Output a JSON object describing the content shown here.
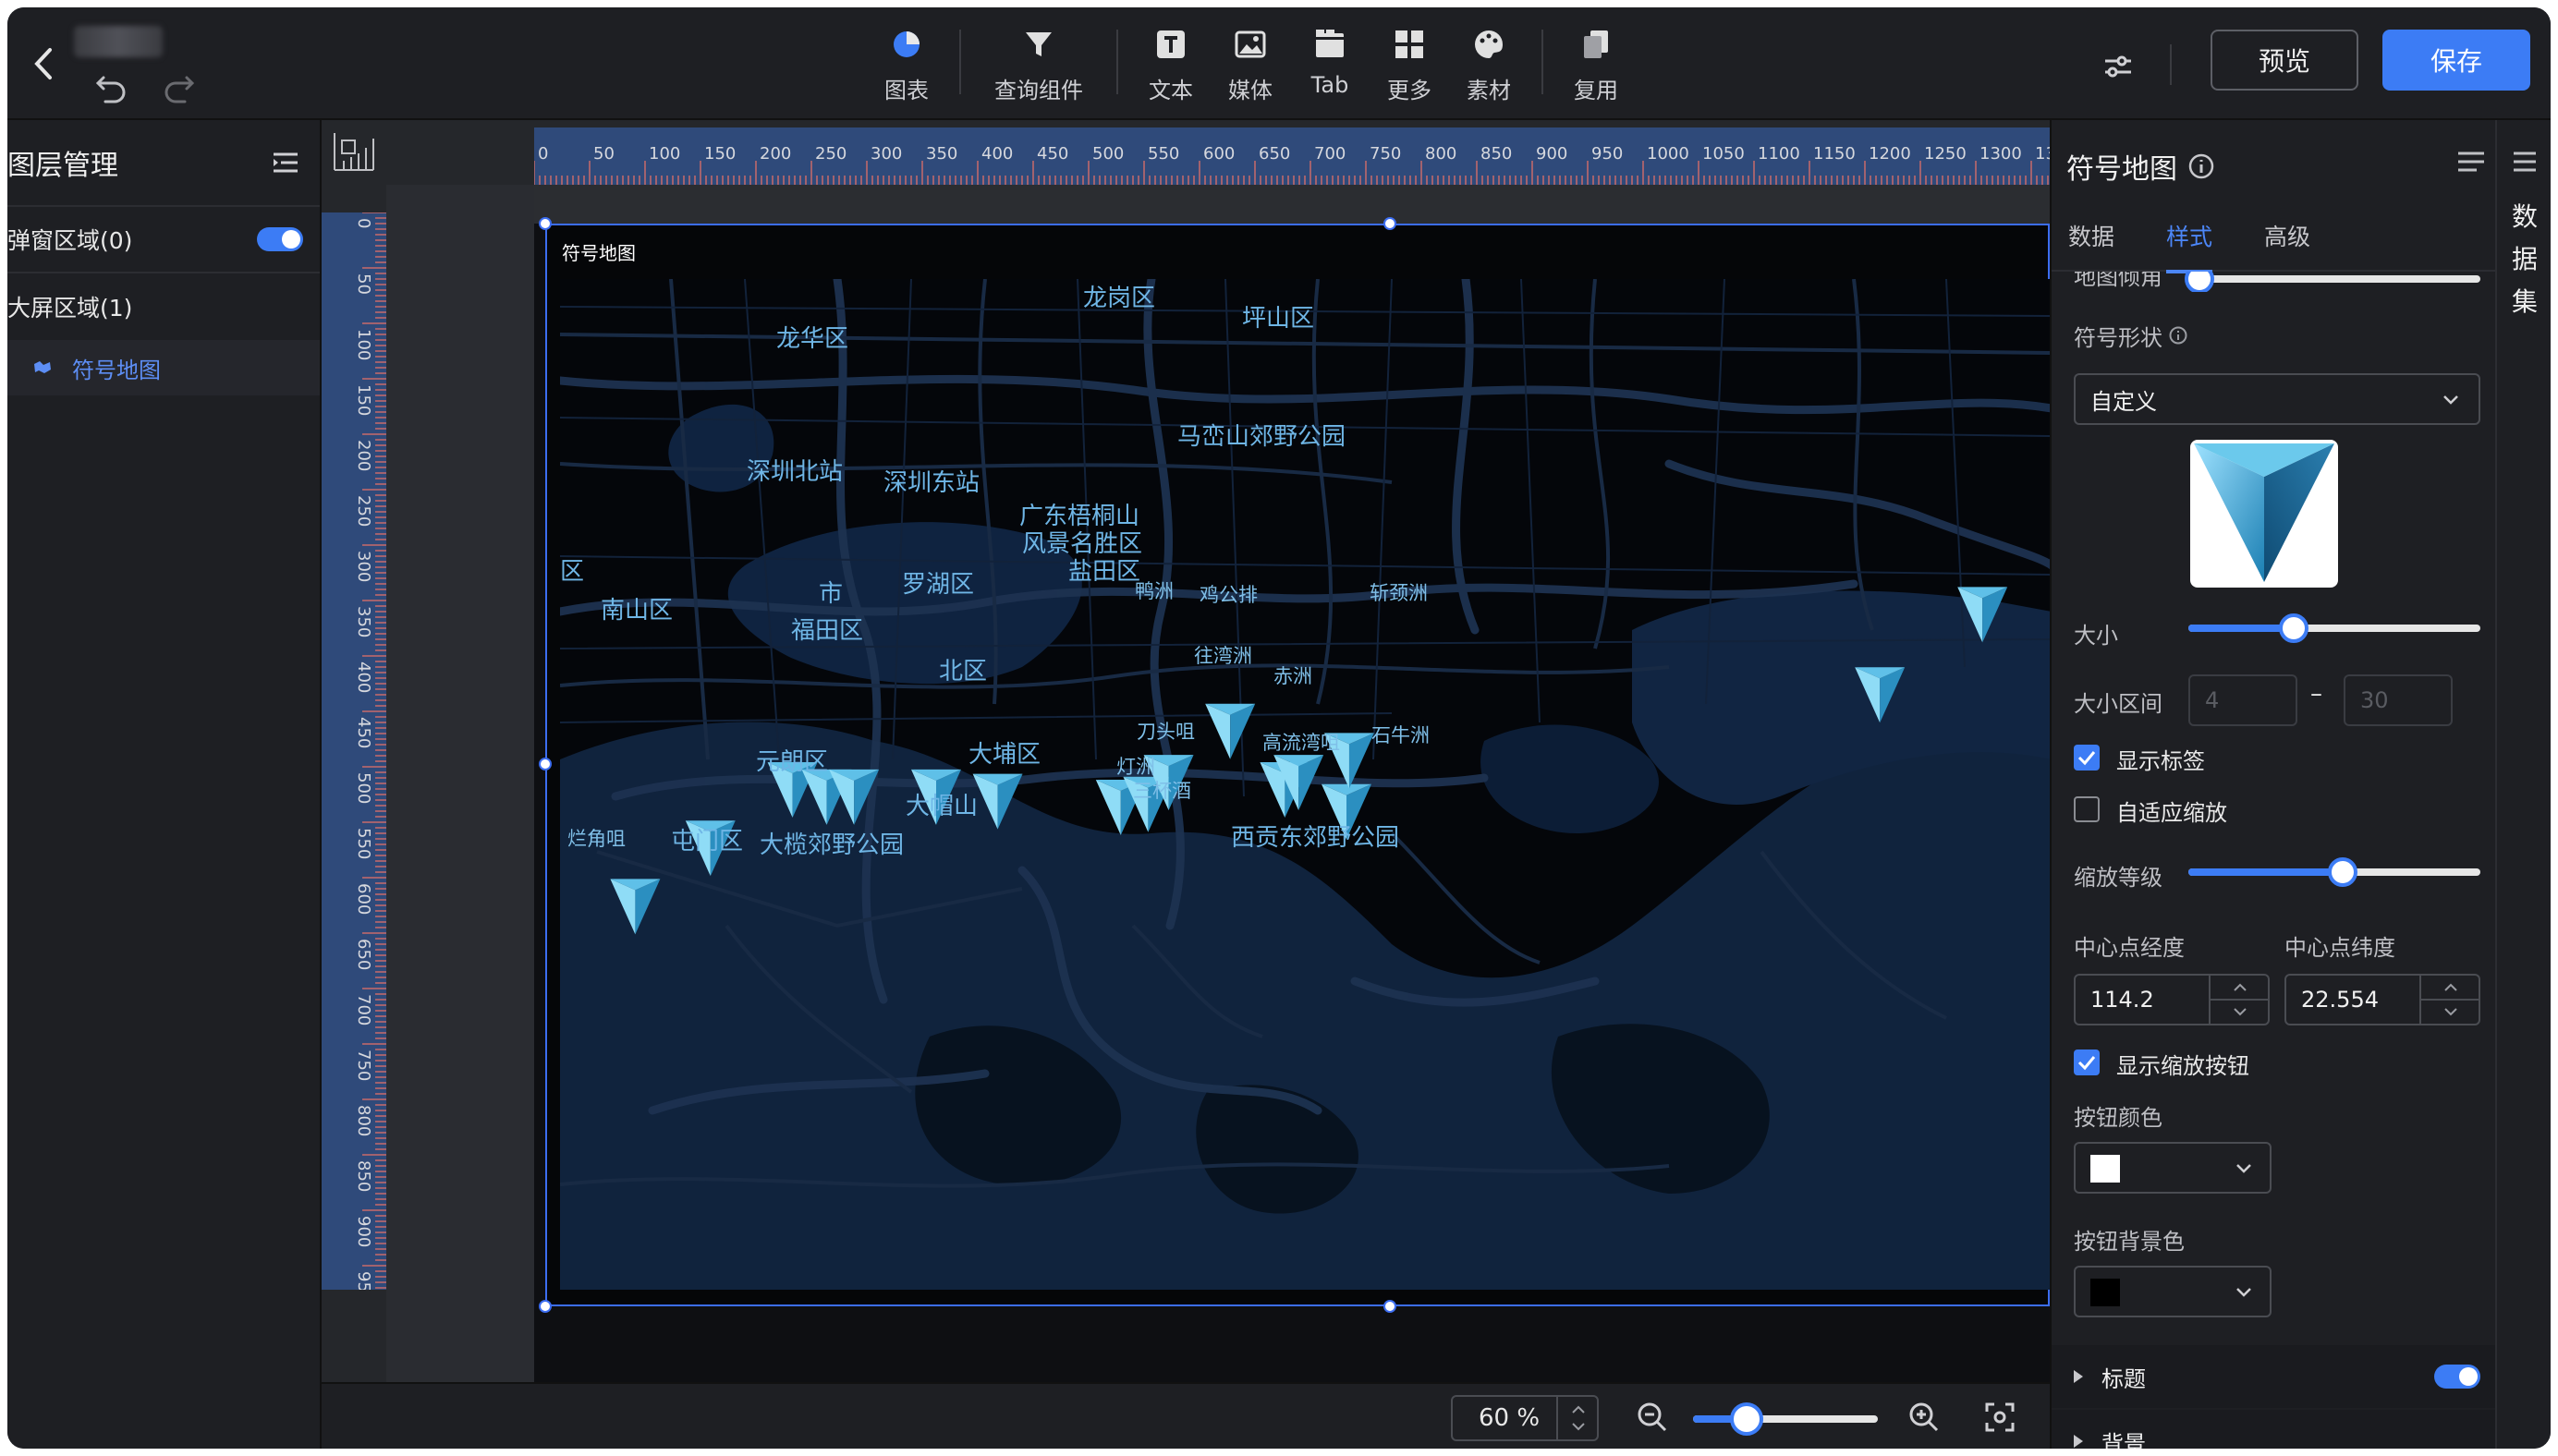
{
  "toolbar": {
    "tools": [
      {
        "label": "图表",
        "icon": "pie-chart-icon"
      },
      {
        "label": "查询组件",
        "icon": "filter-icon"
      },
      {
        "label": "文本",
        "icon": "text-icon"
      },
      {
        "label": "媒体",
        "icon": "image-icon"
      },
      {
        "label": "Tab",
        "icon": "tab-icon"
      },
      {
        "label": "更多",
        "icon": "grid-icon"
      },
      {
        "label": "素材",
        "icon": "palette-icon"
      },
      {
        "label": "复用",
        "icon": "copy-icon"
      }
    ],
    "preview_label": "预览",
    "save_label": "保存"
  },
  "layers": {
    "title": "图层管理",
    "popup_region": "弹窗区域(0)",
    "screen_region": "大屏区域(1)",
    "items": [
      {
        "label": "符号地图",
        "icon": "map-icon"
      }
    ]
  },
  "widget": {
    "title": "符号地图",
    "map_labels": {
      "longgang": "龙岗区",
      "pingshan": "坪山区",
      "longhua": "龙华区",
      "maluanshan": "马峦山郊野公园",
      "szbei": "深圳北站",
      "szdong": "深圳东站",
      "wutong1": "广东梧桐山",
      "wutong2": "风景名胜区",
      "yantian": "盐田区",
      "qu": "区",
      "shi": "市",
      "luohu": "罗湖区",
      "nanshan": "南山区",
      "futian": "福田区",
      "yazhou": "鸭洲",
      "jigongpai": "鸡公排",
      "zhanjingzhou": "斩颈洲",
      "beiqu": "北区",
      "wanzhou": "往湾洲",
      "chizhou": "赤洲",
      "daotouju": "刀头咀",
      "gaoliuwan": "高流湾咀",
      "shizhou": "石牛洲",
      "yuanlang": "元朗区",
      "dapu": "大埔区",
      "dengzhou": "灯洲",
      "sanbeijiu": "三杯酒",
      "damaoshan": "大帽山",
      "lanjiaozui": "烂角咀",
      "tunmen": "屯门区",
      "dalan": "大榄郊野公园",
      "xigong": "西贡东郊野公园"
    }
  },
  "zoom": {
    "value": "60 %",
    "level": 0.28
  },
  "panel": {
    "title": "符号地图",
    "tabs": [
      "数据",
      "样式",
      "高级"
    ],
    "cut_label": "地图倾角",
    "shape_label": "符号形状",
    "shape_value": "自定义",
    "size_label": "大小",
    "size_level": 0.36,
    "range_label": "大小区间",
    "range_min": "4",
    "range_max": "30",
    "show_label": "显示标签",
    "adaptive_zoom": "自适应缩放",
    "zoom_level_label": "缩放等级",
    "zoom_level": 0.53,
    "lng_label": "中心点经度",
    "lat_label": "中心点纬度",
    "lng_value": "114.2",
    "lat_value": "22.554",
    "show_zoom_btn": "显示缩放按钮",
    "btn_color_label": "按钮颜色",
    "btn_bg_label": "按钮背景色",
    "section_title": "标题",
    "section_bg": "背景"
  },
  "rail": {
    "label": "数\n据\n集"
  },
  "colors": {
    "accent": "#3c7cf5",
    "marker": "#5fc0e8",
    "map_label": "#6fb6e6"
  }
}
